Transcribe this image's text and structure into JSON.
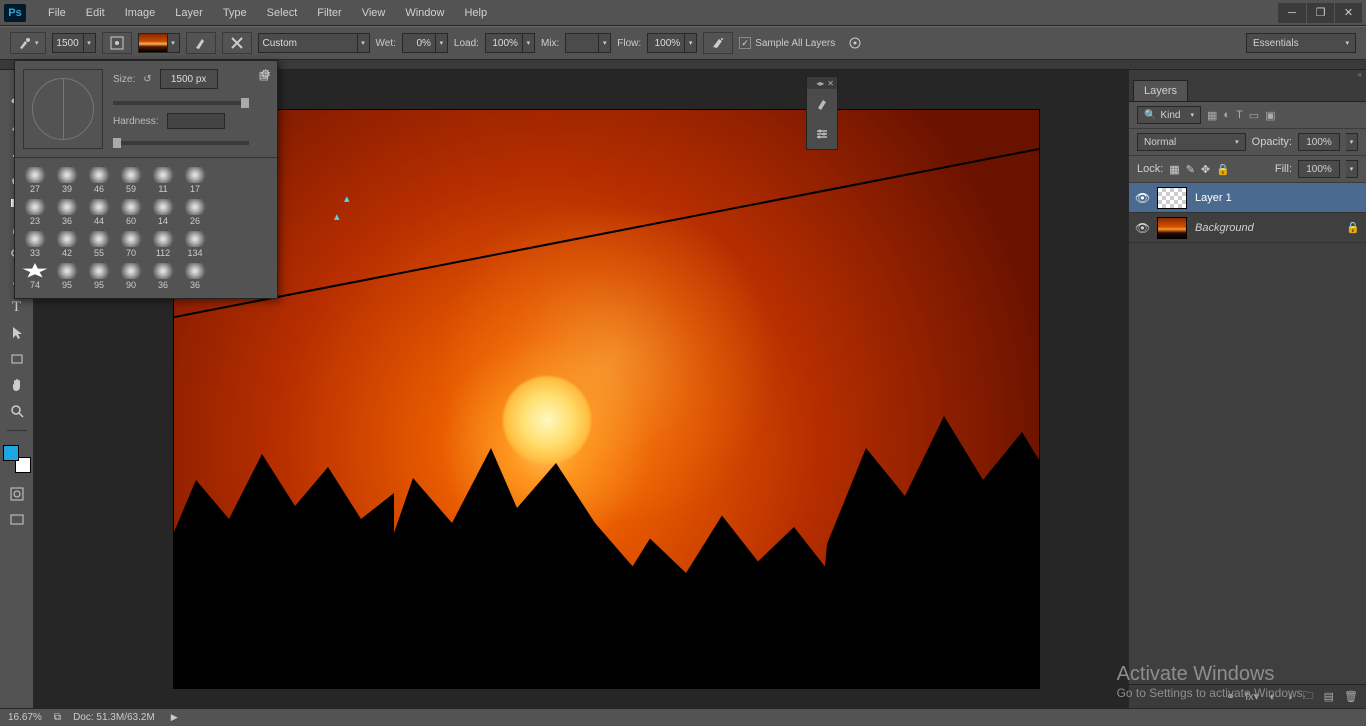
{
  "app": {
    "logo": "Ps"
  },
  "menu": {
    "items": [
      "File",
      "Edit",
      "Image",
      "Layer",
      "Type",
      "Select",
      "Filter",
      "View",
      "Window",
      "Help"
    ]
  },
  "options": {
    "brush_size_badge": "1500",
    "mode_select": "Custom",
    "wet_label": "Wet:",
    "wet_value": "0%",
    "load_label": "Load:",
    "load_value": "100%",
    "mix_label": "Mix:",
    "mix_value": "",
    "flow_label": "Flow:",
    "flow_value": "100%",
    "sample_label": "Sample All Layers",
    "workspace": "Essentials"
  },
  "brush_popup": {
    "size_label": "Size:",
    "size_value": "1500 px",
    "hardness_label": "Hardness:",
    "presets": [
      [
        "27",
        "39",
        "46",
        "59",
        "11",
        "17"
      ],
      [
        "23",
        "36",
        "44",
        "60",
        "14",
        "26"
      ],
      [
        "33",
        "42",
        "55",
        "70",
        "112",
        "134"
      ],
      [
        "74",
        "95",
        "95",
        "90",
        "36",
        "36"
      ]
    ]
  },
  "layers": {
    "tab": "Layers",
    "kind_label": "Kind",
    "blend_mode": "Normal",
    "opacity_label": "Opacity:",
    "opacity_value": "100%",
    "lock_label": "Lock:",
    "fill_label": "Fill:",
    "fill_value": "100%",
    "items": [
      {
        "name": "Layer 1",
        "locked": false,
        "selected": true,
        "thumb": "checker"
      },
      {
        "name": "Background",
        "locked": true,
        "selected": false,
        "thumb": "img"
      }
    ]
  },
  "status": {
    "zoom": "16.67%",
    "doc_label": "Doc:",
    "doc_value": "51.3M/63.2M"
  },
  "watermark": {
    "line1": "Activate Windows",
    "line2": "Go to Settings to activate Windows."
  }
}
